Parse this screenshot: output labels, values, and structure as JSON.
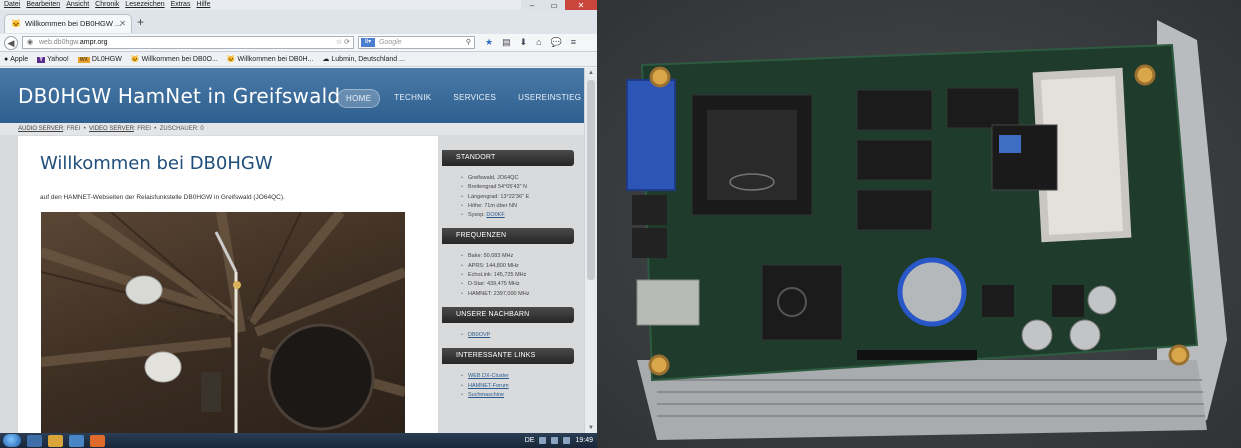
{
  "browser": {
    "menu": [
      "Datei",
      "Bearbeiten",
      "Ansicht",
      "Chronik",
      "Lesezeichen",
      "Extras",
      "Hilfe"
    ],
    "tab_title": "Willkommen bei DB0HGW ...",
    "url_prefix": "web.db0hgw.",
    "url_domain": "ampr.org",
    "search_engine": "Google",
    "bookmarks": [
      "Apple",
      "Yahoo!",
      "DL0HGW",
      "Willkommen bei DB0O...",
      "Willkommen bei DB0H...",
      "Lubmin, Deutschland ..."
    ]
  },
  "site": {
    "title": "DB0HGW HamNet in Greifswald",
    "nav": [
      "HOME",
      "TECHNIK",
      "SERVICES",
      "USEREINSTIEG"
    ],
    "status": {
      "audio_label": "AUDIO SERVER",
      "audio_value": ": FREI",
      "video_label": "VIDEO SERVER",
      "video_value": ": FREI",
      "listeners": "ZUSCHAUER: 0"
    },
    "heading": "Willkommen bei DB0HGW",
    "intro": "auf den HAMNET-Webseiten der Relaisfunkstelle DB0HGW in Greifswald (JO64QC)."
  },
  "sidebar": {
    "standort": {
      "title": "STANDORT",
      "items": [
        "Greifswald, JO64QC",
        "Breitengrad 54°05'43\" N",
        "Längengrad: 13°22'36\" E",
        "Höhe: 71m über NN"
      ],
      "sysop_label": "Sysop: ",
      "sysop_link": "DO0KF"
    },
    "frequenzen": {
      "title": "FREQUENZEN",
      "items": [
        "Bake: 50,083 MHz",
        "APRS: 144,800 MHz",
        "EchoLink: 145,725 MHz",
        "D-Star: 439,475 MHz",
        "HAMNET: 2397,000 MHz"
      ]
    },
    "nachbarn": {
      "title": "UNSERE NACHBARN",
      "items": [
        "DB0OVP"
      ]
    },
    "links": {
      "title": "INTERESSANTE LINKS",
      "items": [
        "WEB DX-Cluster",
        "HAMNET-Forum",
        "Suchmaschine"
      ]
    }
  },
  "taskbar": {
    "lang": "DE",
    "clock": "19:49"
  }
}
